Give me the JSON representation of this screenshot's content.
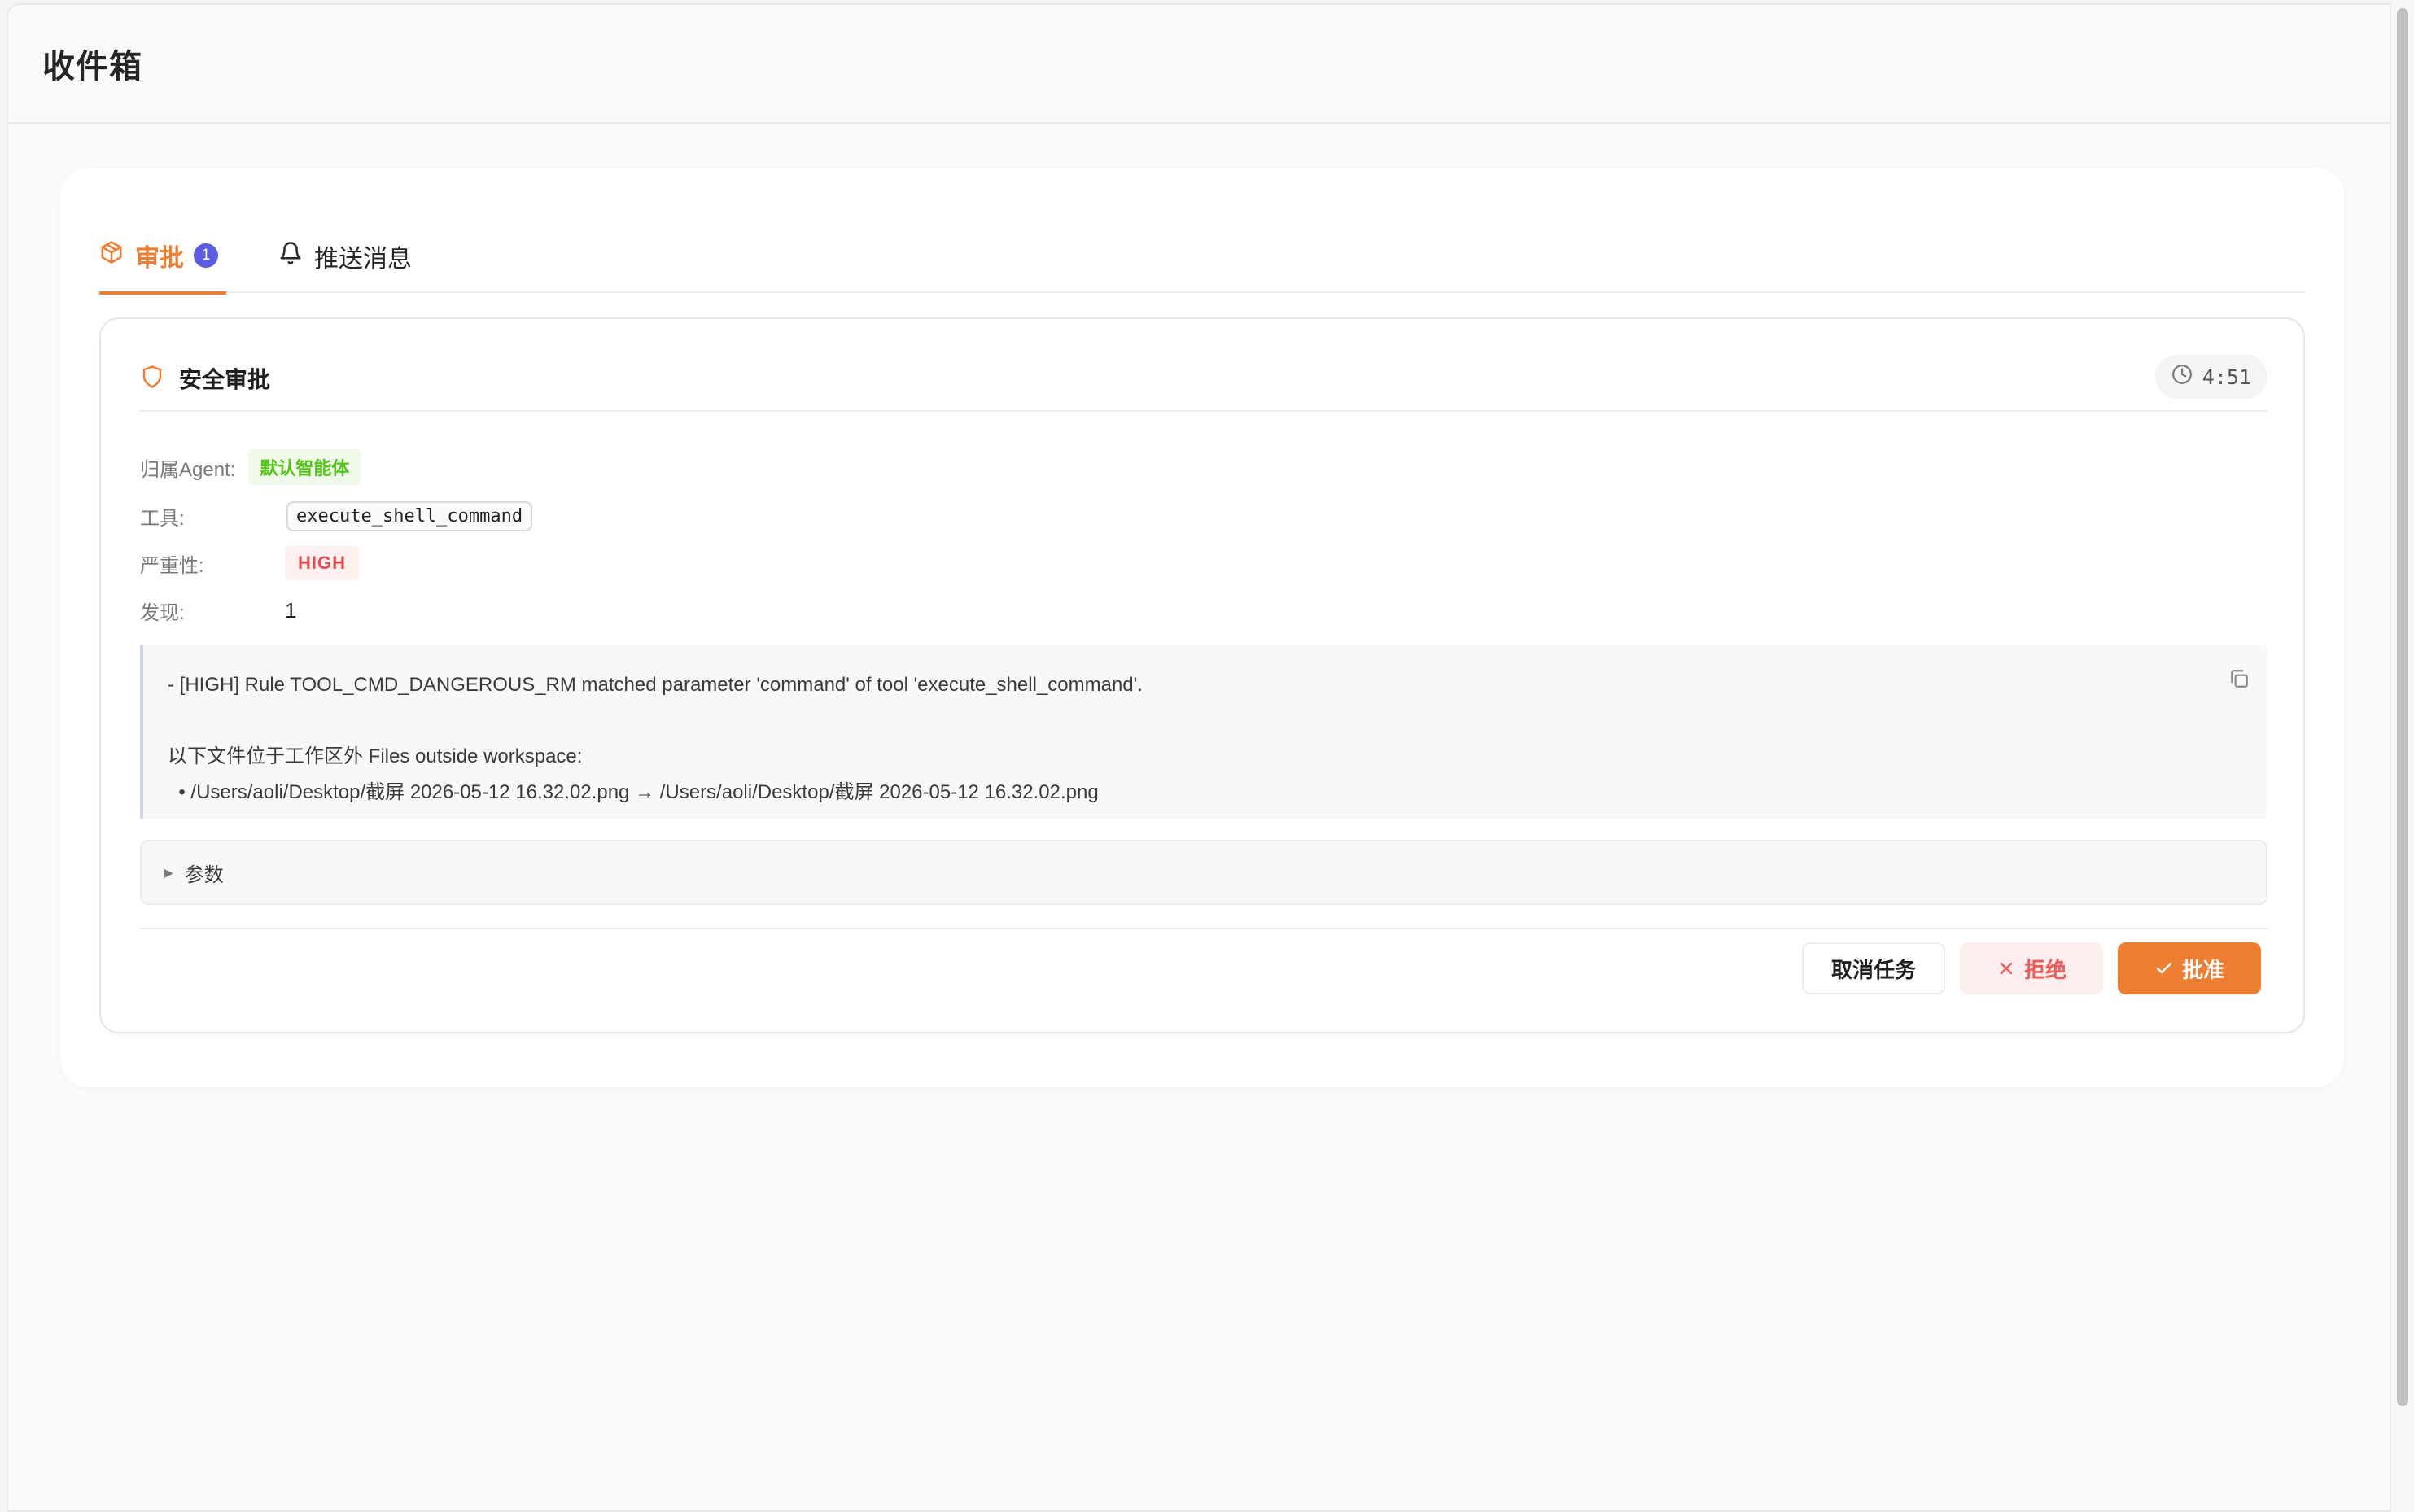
{
  "page": {
    "title": "收件箱"
  },
  "tabs": {
    "approvals": {
      "label": "审批",
      "count": "1",
      "icon": "package-icon"
    },
    "push": {
      "label": "推送消息",
      "icon": "bell-icon"
    }
  },
  "card": {
    "title": "安全审批",
    "icon": "shield-icon",
    "timer": "4:51",
    "meta": {
      "agent_label": "归属Agent:",
      "agent_value": "默认智能体",
      "tool_label": "工具:",
      "tool_value": "execute_shell_command",
      "severity_label": "严重性:",
      "severity_value": "HIGH",
      "findings_label": "发现:",
      "findings_value": "1"
    },
    "detail": {
      "line1": "- [HIGH] Rule TOOL_CMD_DANGEROUS_RM matched parameter 'command' of tool 'execute_shell_command'.",
      "line2": "以下文件位于工作区外 Files outside workspace:",
      "line3": "  • /Users/aoli/Desktop/截屏 2026-05-12 16.32.02.png → /Users/aoli/Desktop/截屏 2026-05-12 16.32.02.png"
    },
    "params_label": "参数",
    "buttons": {
      "cancel": "取消任务",
      "reject": "拒绝",
      "approve": "批准"
    }
  },
  "colors": {
    "accent": "#ed7d31",
    "badge": "#5b5ce2",
    "agent_tag": "#52c41a",
    "severity": "#e5484d"
  }
}
